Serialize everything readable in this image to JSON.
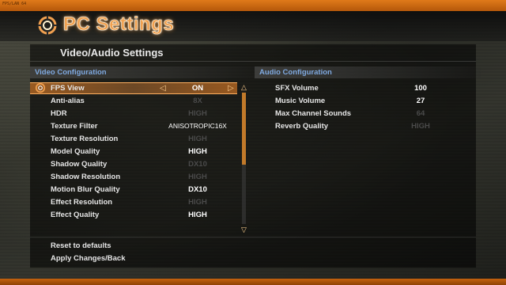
{
  "window": {
    "corner_text": "FPS/LAN 64",
    "title": "PC Settings"
  },
  "page": {
    "title": "Video/Audio Settings"
  },
  "video": {
    "heading": "Video Configuration",
    "selected_index": 0,
    "rows": [
      {
        "label": "FPS View",
        "value": "ON",
        "enabled": true
      },
      {
        "label": "Anti-alias",
        "value": "8X",
        "enabled": false
      },
      {
        "label": "HDR",
        "value": "HIGH",
        "enabled": false
      },
      {
        "label": "Texture Filter",
        "value": "ANISOTROPIC16X",
        "enabled": true
      },
      {
        "label": "Texture Resolution",
        "value": "HIGH",
        "enabled": false
      },
      {
        "label": "Model Quality",
        "value": "HIGH",
        "enabled": true
      },
      {
        "label": "Shadow Quality",
        "value": "DX10",
        "enabled": false
      },
      {
        "label": "Shadow Resolution",
        "value": "HIGH",
        "enabled": false
      },
      {
        "label": "Motion Blur Quality",
        "value": "DX10",
        "enabled": true
      },
      {
        "label": "Effect Resolution",
        "value": "HIGH",
        "enabled": false
      },
      {
        "label": "Effect Quality",
        "value": "HIGH",
        "enabled": true
      }
    ],
    "scroll_position": 0.0,
    "scroll_visible_fraction": 0.55
  },
  "audio": {
    "heading": "Audio Configuration",
    "rows": [
      {
        "label": "SFX Volume",
        "value": "100",
        "enabled": true
      },
      {
        "label": "Music Volume",
        "value": "27",
        "enabled": true
      },
      {
        "label": "Max Channel Sounds",
        "value": "64",
        "enabled": false
      },
      {
        "label": "Reverb Quality",
        "value": "HIGH",
        "enabled": false
      }
    ]
  },
  "footer": {
    "reset_label": "Reset to defaults",
    "apply_label": "Apply Changes/Back"
  },
  "icons": {
    "logo": "target-ring-icon",
    "selection": "target-ring-icon",
    "left": "arrow-left-icon",
    "right": "arrow-right-icon",
    "up": "scroll-up-icon",
    "down": "scroll-down-icon"
  },
  "colors": {
    "accent": "#e07a1a",
    "heading_blue": "#7fa9e0",
    "title_orange": "#f0a050"
  }
}
